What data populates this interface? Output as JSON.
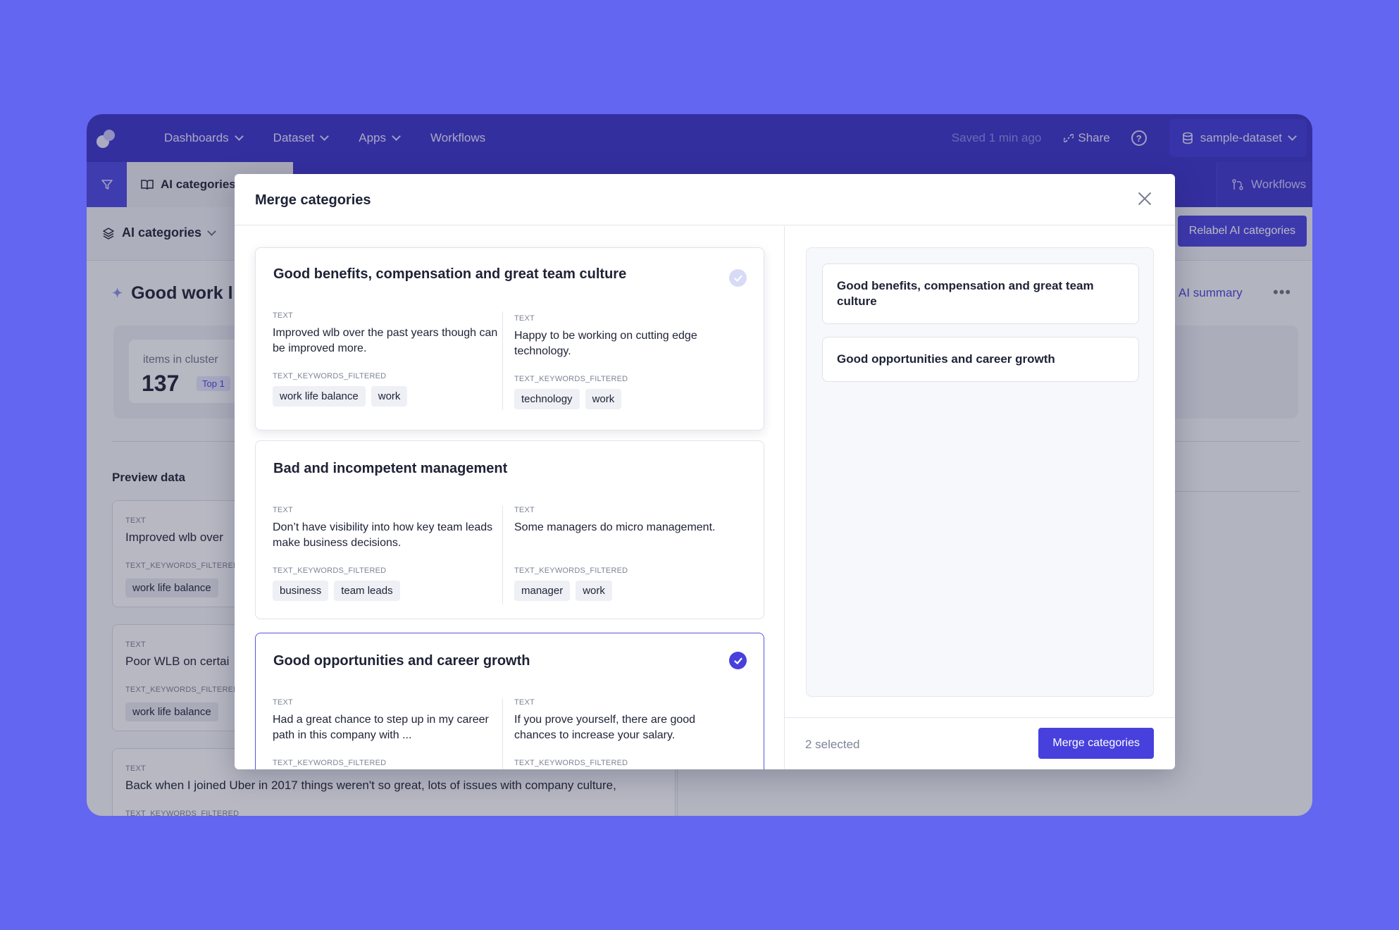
{
  "topbar": {
    "nav": [
      {
        "label": "Dashboards",
        "dropdown": true
      },
      {
        "label": "Dataset",
        "dropdown": true
      },
      {
        "label": "Apps",
        "dropdown": true
      },
      {
        "label": "Workflows",
        "dropdown": false
      }
    ],
    "saved_status": "Saved 1 min ago",
    "share_label": "Share",
    "dataset_label": "sample-dataset"
  },
  "tabs": {
    "active_tab": "AI categories",
    "right_tab": "Workflows"
  },
  "subbar": {
    "selector_label": "AI categories",
    "relabel_button": "Relabel AI categories"
  },
  "background": {
    "cluster_title": "Good work l",
    "ai_summary": "AI summary",
    "stat_label": "items in cluster",
    "stat_value": "137",
    "stat_badge": "Top 1",
    "preview_title": "Preview data",
    "preview_cards": [
      {
        "label": "TEXT",
        "text": "Improved wlb over",
        "kw_label": "TEXT_KEYWORDS_FILTERED",
        "chip": "work life balance"
      },
      {
        "label": "TEXT",
        "text": "Poor WLB on certai",
        "kw_label": "TEXT_KEYWORDS_FILTERED",
        "chip": "work life balance"
      }
    ],
    "preview_wide": {
      "label": "TEXT",
      "text": "Back when I joined Uber in 2017 things weren't so great, lots of issues with company culture,",
      "kw_label": "TEXT_KEYWORDS_FILTERED"
    }
  },
  "modal": {
    "title": "Merge categories",
    "categories": [
      {
        "title": "Good benefits, compensation and great team culture",
        "selected": true,
        "items": [
          {
            "label": "TEXT",
            "text": "Improved wlb over the past years though can be improved more.",
            "kw_label": "TEXT_KEYWORDS_FILTERED",
            "chips": [
              "work life balance",
              "work"
            ]
          },
          {
            "label": "TEXT",
            "text": "Happy to be working on cutting edge technology.",
            "kw_label": "TEXT_KEYWORDS_FILTERED",
            "chips": [
              "technology",
              "work"
            ]
          }
        ]
      },
      {
        "title": "Bad and incompetent management",
        "selected": false,
        "items": [
          {
            "label": "TEXT",
            "text": "Don’t have visibility into how key team leads make business decisions.",
            "kw_label": "TEXT_KEYWORDS_FILTERED",
            "chips": [
              "business",
              "team leads"
            ]
          },
          {
            "label": "TEXT",
            "text": "Some managers do micro management.",
            "kw_label": "TEXT_KEYWORDS_FILTERED",
            "chips": [
              "manager",
              "work"
            ]
          }
        ]
      },
      {
        "title": "Good opportunities and career growth",
        "selected": true,
        "items": [
          {
            "label": "TEXT",
            "text": "Had a great chance to step up in my career path in this company with ...",
            "kw_label": "TEXT_KEYWORDS_FILTERED",
            "chips": []
          },
          {
            "label": "TEXT",
            "text": "If you prove yourself, there are good chances to increase your salary.",
            "kw_label": "TEXT_KEYWORDS_FILTERED",
            "chips": []
          }
        ]
      }
    ],
    "selected_items": [
      "Good benefits, compensation and great team culture",
      "Good opportunities and career growth"
    ],
    "selected_count": "2 selected",
    "merge_button": "Merge categories"
  },
  "colors": {
    "background": "#6366f0",
    "topbar": "#3a32c9",
    "accent": "#4740dd"
  }
}
